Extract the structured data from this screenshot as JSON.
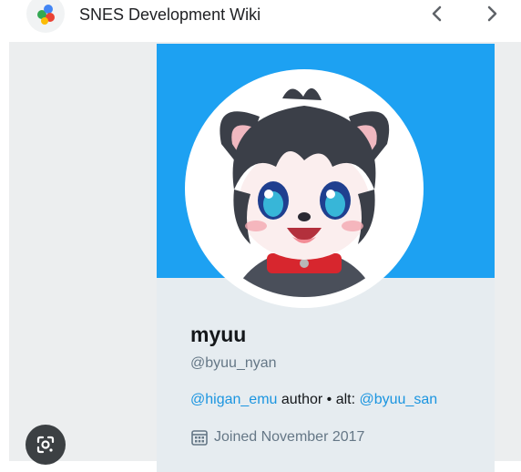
{
  "app": {
    "title": "SNES Development Wiki",
    "logo_icon": "app-logo-icon"
  },
  "nav": {
    "back_icon": "chevron-left-icon",
    "forward_icon": "chevron-right-icon"
  },
  "colors": {
    "banner": "#1da1f2",
    "link": "#1b95e0",
    "card_bg": "#e6ecf0"
  },
  "profile": {
    "name": "myuu",
    "handle": "@byuu_nyan",
    "bio": {
      "link1": "@higan_emu",
      "text1": " author • alt: ",
      "link2": "@byuu_san"
    },
    "joined": "Joined November 2017",
    "joined_icon": "calendar-icon",
    "avatar_icon": "anime-wolf-avatar"
  },
  "lens": {
    "icon": "google-lens-icon"
  }
}
